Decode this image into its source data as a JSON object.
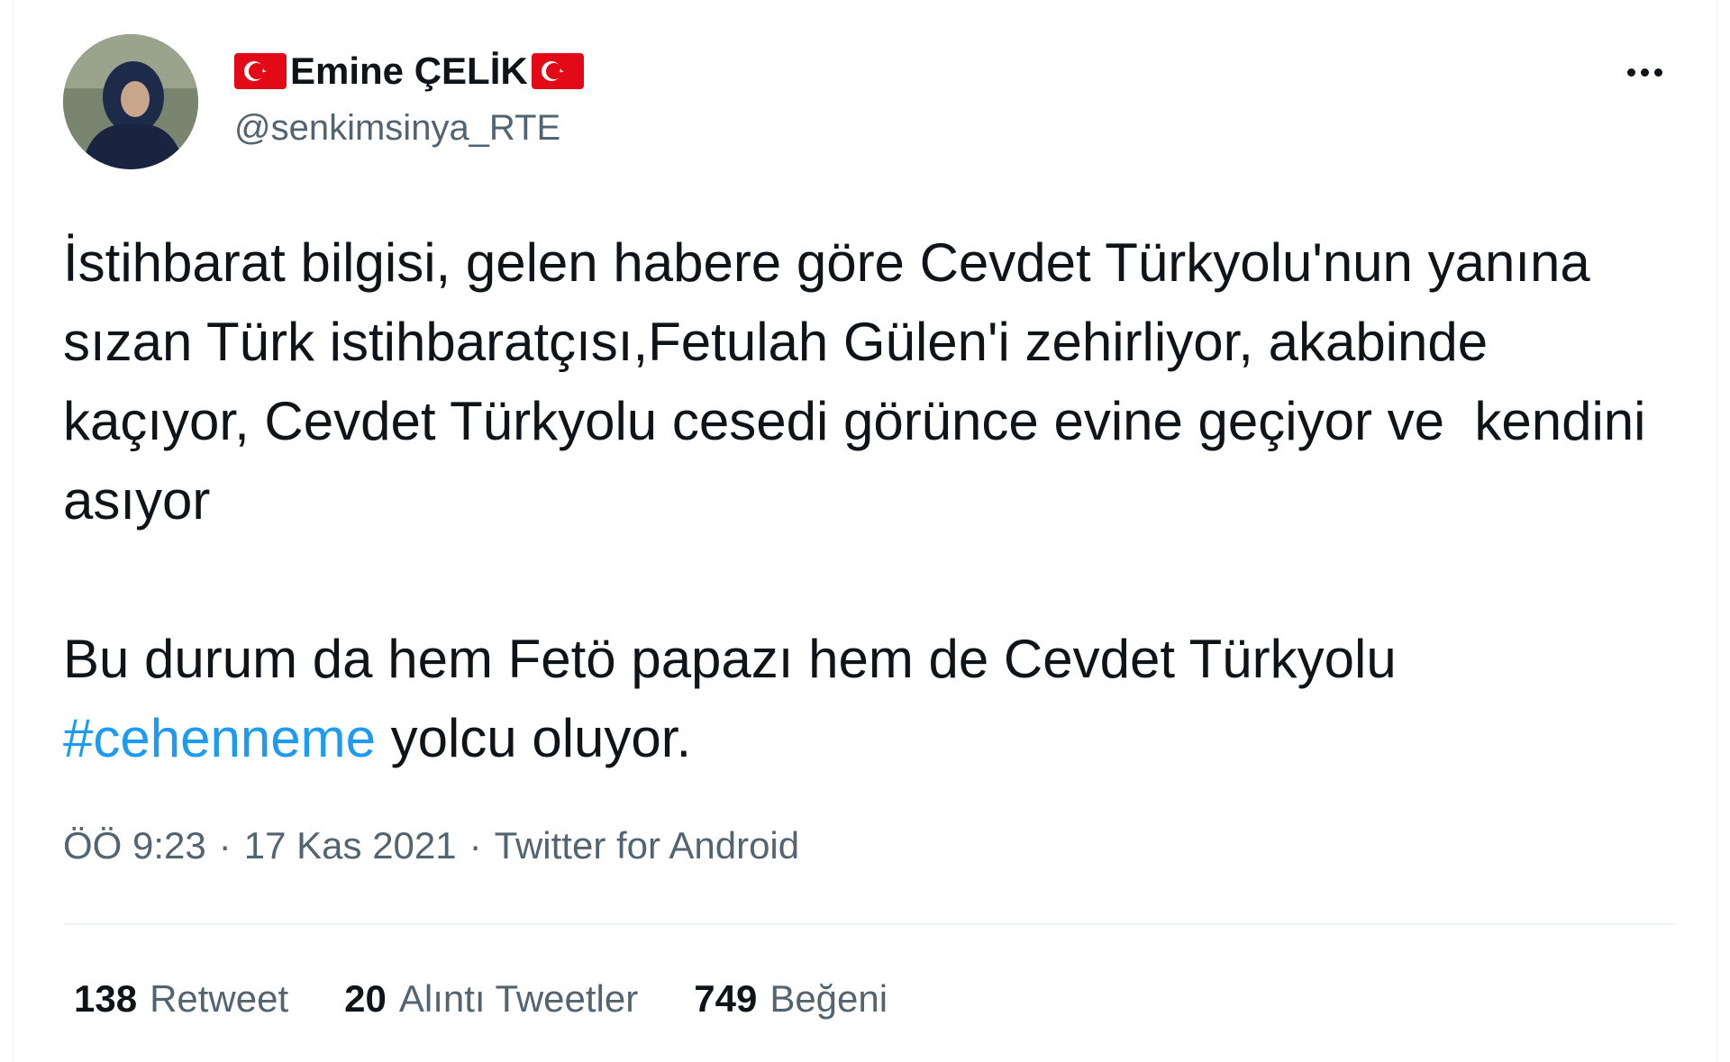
{
  "user": {
    "display_name": "Emine ÇELİK",
    "handle": "@senkimsinya_RTE",
    "name_prefix_icon": "turkey-flag-icon",
    "name_suffix_icon": "turkey-flag-icon"
  },
  "tweet": {
    "paragraph1": "İstihbarat bilgisi, gelen habere göre Cevdet Türkyolu'nun yanına sızan Türk istihbaratçısı,Fetulah Gülen'i zehirliyor, akabinde kaçıyor, Cevdet Türkyolu cesedi görünce evine geçiyor ve  kendini asıyor",
    "paragraph2_before": "Bu durum da hem Fetö papazı hem de Cevdet Türkyolu ",
    "hashtag": "#cehenneme",
    "paragraph2_after": " yolcu oluyor."
  },
  "meta": {
    "time": "ÖÖ 9:23",
    "separator": "·",
    "date": "17 Kas 2021",
    "source": "Twitter for Android"
  },
  "stats": {
    "retweets_count": "138",
    "retweets_label": "Retweet",
    "quotes_count": "20",
    "quotes_label": "Alıntı Tweetler",
    "likes_count": "749",
    "likes_label": "Beğeni"
  },
  "colors": {
    "text": "#0f1419",
    "secondary": "#536471",
    "link": "#1d9bf0",
    "flag_red": "#e30a17"
  }
}
